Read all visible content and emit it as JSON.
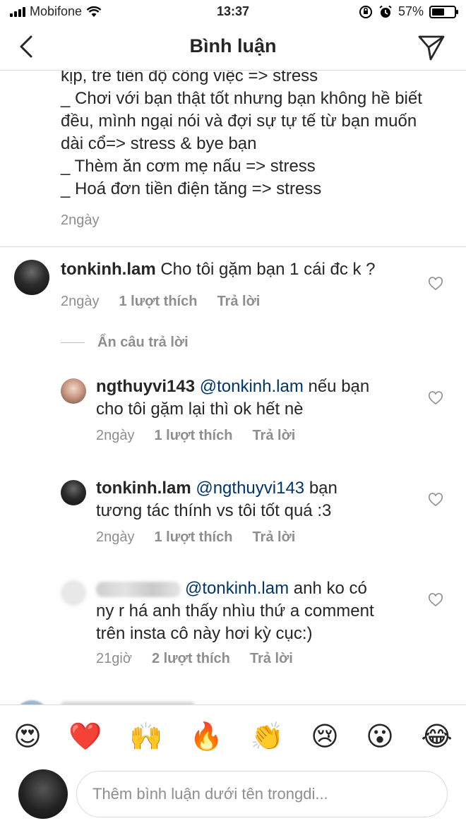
{
  "status_bar": {
    "carrier": "Mobifone",
    "time": "13:37",
    "battery_percent": "57%",
    "battery_level": 0.57
  },
  "header": {
    "title": "Bình luận"
  },
  "caption": {
    "lines": [
      "kịp, trễ tiến độ công việc => stress",
      "_ Chơi với bạn thật tốt nhưng bạn không hề biết",
      "đều, mình ngại nói và đợi sự tự tế từ bạn muốn",
      "dài cổ=> stress & bye bạn",
      "_ Thèm ăn cơm mẹ nấu => stress",
      "_ Hoá đơn tiền điện tăng => stress"
    ],
    "time": "2ngày"
  },
  "comments": [
    {
      "username": "tonkinh.lam",
      "mention": "",
      "text": "Cho tôi gặm bạn 1 cái đc k ?",
      "time": "2ngày",
      "likes": "1 lượt thích",
      "reply": "Trả lời"
    }
  ],
  "hide_replies_label": "Ẩn câu trả lời",
  "replies": [
    {
      "username": "ngthuyvi143",
      "mention": "@tonkinh.lam",
      "line1": "nếu bạn",
      "line2": "cho tôi gặm lại thì ok hết nè",
      "time": "2ngày",
      "likes": "1 lượt thích",
      "reply": "Trả lời"
    },
    {
      "username": "tonkinh.lam",
      "mention": "@ngthuyvi143",
      "line1": "bạn",
      "line2": "tương tác thính vs tôi tốt quá :3",
      "time": "2ngày",
      "likes": "1 lượt thích",
      "reply": "Trả lời"
    },
    {
      "username": "",
      "mention": "@tonkinh.lam",
      "line1": "anh ko có",
      "line2": "ny r há anh thấy nhìu thứ a comment",
      "line3": "trên insta cô này hơi kỳ cục:)",
      "time": "21giờ",
      "likes": "2 lượt thích",
      "reply": "Trả lời"
    }
  ],
  "emoji_bar": [
    "😍",
    "❤️",
    "🙌",
    "🔥",
    "👏",
    "😢",
    "😮",
    "😂"
  ],
  "input": {
    "placeholder": "Thêm bình luận dưới tên trongdi..."
  }
}
